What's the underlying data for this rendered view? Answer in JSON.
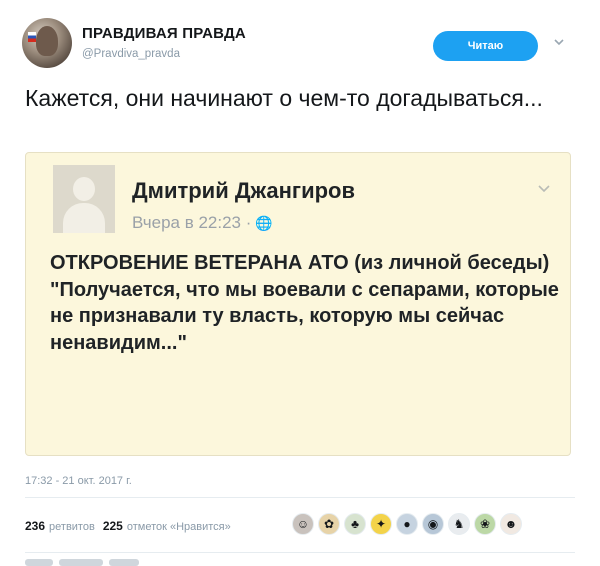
{
  "header": {
    "display_name": "ПРАВДИВАЯ ПРАВДА",
    "username": "@Pravdiva_pravda",
    "follow_label": "Читаю",
    "avatar_icon": "profile-photo"
  },
  "tweet": {
    "text": "Кажется, они начинают о чем-то догадываться..."
  },
  "quote": {
    "author": "Дмитрий Джангиров",
    "time": "Вчера в 22:23 ·",
    "globe_icon": "🌐",
    "lines": [
      "ОТКРОВЕНИЕ ВЕТЕРАНА АТО (из личной беседы)",
      "\"Получается, что мы воевали с сепарами, которые не признавали ту власть, которую мы сейчас ненавидим...\""
    ],
    "background_color": "#fcf7dc"
  },
  "meta": {
    "timestamp": "17:32 - 21 окт. 2017 г."
  },
  "stats": {
    "retweets_count": "236",
    "retweets_label": "ретвитов",
    "likes_count": "225",
    "likes_label": "отметок «Нравится»"
  },
  "likers": [
    {
      "icon": "liker-avatar",
      "glyph": "☺",
      "color": "#c9c2bd"
    },
    {
      "icon": "liker-avatar",
      "glyph": "✿",
      "color": "#e7d3a8"
    },
    {
      "icon": "liker-avatar",
      "glyph": "♣",
      "color": "#d7e3cf"
    },
    {
      "icon": "liker-avatar",
      "glyph": "✦",
      "color": "#f3d34a"
    },
    {
      "icon": "liker-avatar",
      "glyph": "●",
      "color": "#c6d3e0"
    },
    {
      "icon": "liker-avatar",
      "glyph": "◉",
      "color": "#b7c7d7"
    },
    {
      "icon": "liker-avatar",
      "glyph": "♞",
      "color": "#e9ecef"
    },
    {
      "icon": "liker-avatar",
      "glyph": "❀",
      "color": "#bcd8a6"
    },
    {
      "icon": "liker-avatar",
      "glyph": "☻",
      "color": "#f1e9e2"
    }
  ],
  "colors": {
    "accent": "#1da1f2"
  }
}
